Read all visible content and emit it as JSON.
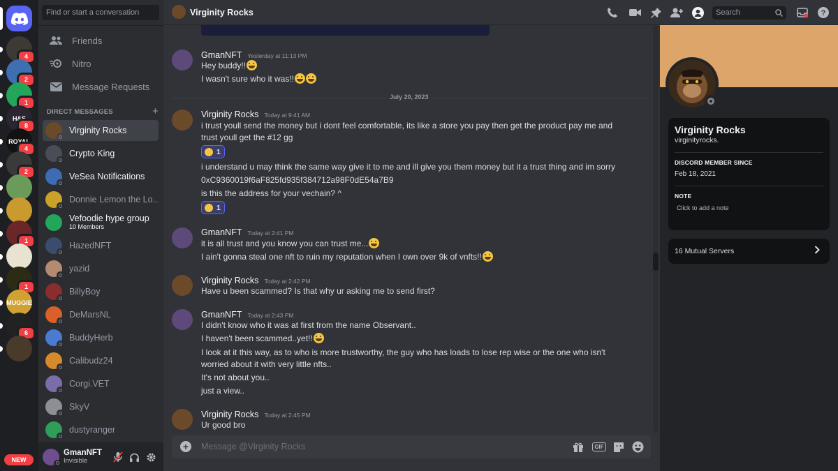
{
  "dm_sidebar": {
    "search_placeholder": "Find or start a conversation",
    "nav": [
      {
        "label": "Friends",
        "icon": "friends-icon"
      },
      {
        "label": "Nitro",
        "icon": "nitro-icon"
      },
      {
        "label": "Message Requests",
        "icon": "envelope-icon"
      }
    ],
    "section_title": "DIRECT MESSAGES",
    "dms": [
      {
        "name": "Virginity Rocks",
        "active": true,
        "color": "#6b4a2a"
      },
      {
        "name": "Crypto King",
        "color": "#4a4d55"
      },
      {
        "name": "VeSea Notifications",
        "color": "#3d6bb5"
      },
      {
        "name": "Donnie Lemon the Lo...",
        "color": "#c9a227"
      },
      {
        "name": "Vefoodie hype group",
        "sub": "10 Members",
        "color": "#23a55a"
      },
      {
        "name": "HazedNFT",
        "color": "#3a4d6e"
      },
      {
        "name": "yazid",
        "color": "#b48a72"
      },
      {
        "name": "BillyBoy",
        "color": "#8a2d2d"
      },
      {
        "name": "DeMarsNL",
        "color": "#d9602a"
      },
      {
        "name": "BuddyHerb",
        "color": "#4b7bd1"
      },
      {
        "name": "Calibudz24",
        "color": "#d68a2c"
      },
      {
        "name": "Corgi.VET",
        "color": "#7a6ea8"
      },
      {
        "name": "SkyV",
        "color": "#8d8f94"
      },
      {
        "name": "dustyranger",
        "color": "#2f9e58"
      }
    ],
    "user": {
      "name": "GmanNFT",
      "status": "Invisible"
    }
  },
  "servers": [
    {
      "badge": "4",
      "color": "#3d3a36",
      "label": ""
    },
    {
      "badge": "2",
      "color": "#3e6fb0",
      "label": ""
    },
    {
      "badge": "1",
      "color": "#23a55a",
      "label": ""
    },
    {
      "badge": "8",
      "color": "#2a2530",
      "label": "H&S"
    },
    {
      "badge": "4",
      "color": "#121212",
      "label": "ROYAL"
    },
    {
      "badge": "2",
      "color": "#3a3a3a",
      "label": ""
    },
    {
      "badge": "",
      "color": "#6b9b5a",
      "label": ""
    },
    {
      "badge": "",
      "color": "#c99a2e",
      "label": ""
    },
    {
      "badge": "1",
      "color": "#6b2727",
      "label": ""
    },
    {
      "badge": "",
      "color": "#e8e2d0",
      "label": ""
    },
    {
      "badge": "1",
      "color": "#2c2c14",
      "label": ""
    },
    {
      "badge": "",
      "color": "#d0a233",
      "label": "SMUGGIES"
    },
    {
      "badge": "6",
      "color": "#222",
      "label": ""
    },
    {
      "badge": "",
      "color": "#4a3a2a",
      "label": ""
    }
  ],
  "new_label": "NEW",
  "header": {
    "title": "Virginity Rocks",
    "search_placeholder": "Search"
  },
  "messages": {
    "m1_name": "GmanNFT",
    "m1_time": "Yesterday at 11:13 PM",
    "m1_l1": "Hey buddy!!",
    "m1_l2": "I wasn't sure who it was!!",
    "date_divider": "July 20, 2023",
    "m2_name": "Virginity Rocks",
    "m2_time": "Today at 9:41 AM",
    "m2_l1": "i trust youll send the money but i dont feel comfortable, its like a store you pay then get the product pay me and trust youll get the #12 gg",
    "m2_r1": "1",
    "m2_l2": "i understand u may think the same way give it to me and ill give you them money but it a trust thing and im sorry",
    "m2_l3": "0xC9360019f6aF825fd935f384712a98F0dE54a7B9",
    "m2_l4": "is this the address for your vechain? ^",
    "m2_r2": "1",
    "m3_name": "GmanNFT",
    "m3_time": "Today at 2:41 PM",
    "m3_l1": "it is all trust and you know you can trust me...",
    "m3_l2": "I ain't gonna steal one nft to ruin my reputation when I own over 9k of vnfts!!",
    "m4_name": "Virginity Rocks",
    "m4_time": "Today at 2:42 PM",
    "m4_l1": "Have u been scammed? Is that why ur asking me to send first?",
    "m5_name": "GmanNFT",
    "m5_time": "Today at 2:43 PM",
    "m5_l1": "I didn't know who it was at first from the name Observant..",
    "m5_l2": "I haven't been scammed..yet!!",
    "m5_l3": "I look at it this way,  as to who is more trustworthy,  the guy who has loads to lose rep wise or the one who isn't worried about it with very little nfts..",
    "m5_l4": "It's not about you..",
    "m5_l5": "just a view..",
    "m6_name": "Virginity Rocks",
    "m6_time": "Today at 2:45 PM",
    "m6_l1": "Ur good bro"
  },
  "composer": {
    "placeholder": "Message @Virginity Rocks",
    "gif_label": "GIF"
  },
  "profile": {
    "name": "Virginity Rocks",
    "username": "virginityrocks.",
    "member_since_title": "DISCORD MEMBER SINCE",
    "member_since": "Feb 18, 2021",
    "note_title": "NOTE",
    "note_placeholder": "Click to add a note",
    "mutual_servers": "16 Mutual Servers",
    "banner_color": "#dda56a"
  },
  "colors": {
    "accent": "#5865f2",
    "badge": "#f23f43"
  }
}
